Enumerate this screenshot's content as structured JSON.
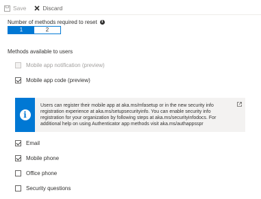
{
  "toolbar": {
    "save_label": "Save",
    "discard_label": "Discard"
  },
  "methods_required": {
    "label": "Number of methods required to reset",
    "options": [
      "1",
      "2"
    ],
    "selected": "1"
  },
  "methods_available": {
    "label": "Methods available to users",
    "items": [
      {
        "label": "Mobile app notification (preview)",
        "checked": false,
        "disabled": true
      },
      {
        "label": "Mobile app code (preview)",
        "checked": true,
        "disabled": false
      },
      {
        "label": "Email",
        "checked": true,
        "disabled": false
      },
      {
        "label": "Mobile phone",
        "checked": true,
        "disabled": false
      },
      {
        "label": "Office phone",
        "checked": false,
        "disabled": false
      },
      {
        "label": "Security questions",
        "checked": false,
        "disabled": false
      }
    ]
  },
  "info_banner": {
    "text": "Users can register their mobile app at aka.ms/mfasetup or in the new security info registration experience at aka.ms/setupsecurityinfo. You can enable security info registration for your organization by following steps at aka.ms/securityinfodocs. For additional help on using Authenticator app methods visit aka.ms/authappsspr"
  },
  "colors": {
    "accent": "#0078d4",
    "banner_bg": "#f3f2f1",
    "disabled_text": "#a19f9d"
  }
}
